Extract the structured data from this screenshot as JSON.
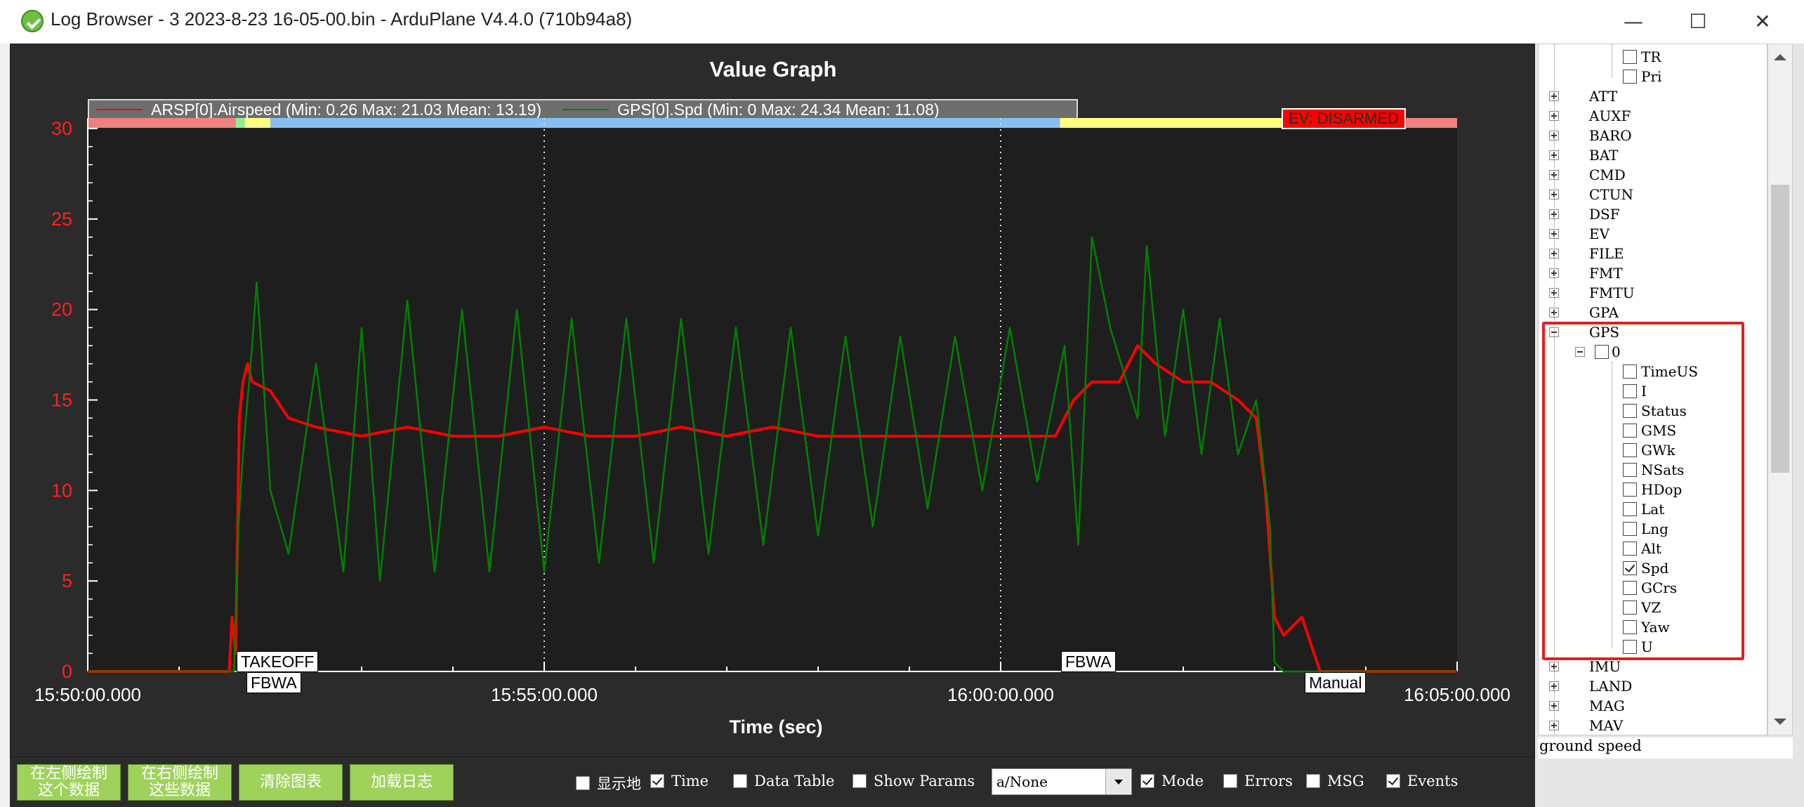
{
  "window": {
    "title": "Log Browser - 3 2023-8-23 16-05-00.bin - ArduPlane V4.4.0 (710b94a8)"
  },
  "graph": {
    "title": "Value Graph",
    "legend": [
      {
        "label": "ARSP[0].Airspeed  (Min: 0.26 Max: 21.03 Mean: 13.19)",
        "color": "#ff0000"
      },
      {
        "label": "GPS[0].Spd  (Min: 0 Max: 24.34 Mean: 11.08)",
        "color": "#008000"
      }
    ],
    "event_label": "EV: DISARMED",
    "modes": [
      "TAKEOFF",
      "FBWA",
      "FBWA",
      "Manual"
    ]
  },
  "chart_data": {
    "type": "line",
    "title": "Value Graph",
    "xlabel": "Time (sec)",
    "ylabel": "",
    "x_ticks": [
      "15:50:00.000",
      "15:55:00.000",
      "16:00:00.000",
      "16:05:00.000"
    ],
    "xlim_minutes": [
      0,
      15
    ],
    "ylim": [
      0,
      30
    ],
    "y_ticks": [
      0,
      5,
      10,
      15,
      20,
      25,
      30
    ],
    "grid": "vertical dotted at major x ticks",
    "series": [
      {
        "name": "ARSP[0].Airspeed",
        "color": "#ff0000",
        "x_minutes": [
          0,
          1.55,
          1.58,
          1.62,
          1.66,
          1.7,
          1.75,
          1.8,
          2.0,
          2.2,
          2.5,
          3.0,
          3.5,
          4.0,
          4.5,
          5.0,
          5.5,
          6.0,
          6.5,
          7.0,
          7.5,
          8.0,
          8.5,
          9.0,
          9.5,
          10.0,
          10.6,
          10.8,
          11.0,
          11.3,
          11.5,
          11.7,
          12.0,
          12.3,
          12.6,
          12.8,
          12.9,
          13.0,
          13.1,
          13.3,
          13.5,
          15
        ],
        "values": [
          0,
          0,
          3,
          1,
          14,
          16,
          17,
          16,
          15.5,
          14,
          13.5,
          13,
          13.5,
          13,
          13,
          13.5,
          13,
          13,
          13.5,
          13,
          13.5,
          13,
          13,
          13,
          13,
          13,
          13,
          15,
          16,
          16,
          18,
          17,
          16,
          16,
          15,
          14,
          10,
          3,
          2,
          3,
          0,
          0
        ]
      },
      {
        "name": "GPS[0].Spd",
        "color": "#008000",
        "x_minutes": [
          0,
          1.6,
          1.65,
          1.7,
          1.8,
          1.85,
          1.9,
          2.0,
          2.2,
          2.5,
          2.8,
          3.0,
          3.2,
          3.5,
          3.8,
          4.1,
          4.4,
          4.7,
          5.0,
          5.3,
          5.6,
          5.9,
          6.2,
          6.5,
          6.8,
          7.1,
          7.4,
          7.7,
          8.0,
          8.3,
          8.6,
          8.9,
          9.2,
          9.5,
          9.8,
          10.1,
          10.4,
          10.7,
          10.85,
          11.0,
          11.2,
          11.5,
          11.6,
          11.8,
          12.0,
          12.2,
          12.4,
          12.6,
          12.8,
          12.95,
          13.0,
          13.1,
          13.3,
          13.5,
          15
        ],
        "values": [
          0,
          0,
          8,
          12,
          18,
          21.5,
          18,
          10,
          6.5,
          17,
          5.5,
          19,
          5,
          20.5,
          5.5,
          20,
          5.5,
          20,
          5.5,
          19.5,
          6,
          19.5,
          6,
          19.5,
          6.5,
          19,
          7,
          19,
          7.5,
          18.5,
          8,
          18.5,
          9,
          18.5,
          10,
          19,
          10.5,
          18,
          7,
          24,
          19,
          14,
          23.5,
          13,
          20,
          12,
          19.5,
          12,
          15,
          8,
          0.5,
          0,
          0,
          0,
          0
        ]
      }
    ],
    "mode_bar": [
      {
        "from_minutes": 0,
        "to_minutes": 1.62,
        "color": "#f08080"
      },
      {
        "from_minutes": 1.62,
        "to_minutes": 1.72,
        "color": "#90ee90"
      },
      {
        "from_minutes": 1.72,
        "to_minutes": 2.0,
        "color": "#ffff80"
      },
      {
        "from_minutes": 2.0,
        "to_minutes": 10.65,
        "color": "#87bff0"
      },
      {
        "from_minutes": 10.65,
        "to_minutes": 13.35,
        "color": "#ffff80"
      },
      {
        "from_minutes": 13.35,
        "to_minutes": 15,
        "color": "#f08080"
      }
    ]
  },
  "controls": {
    "buttons": [
      "在左侧绘制\n这个数据",
      "在右侧绘制\n这些数据",
      "清除图表",
      "加载日志"
    ],
    "show_map_label": "显示地",
    "time_label": "Time",
    "data_table_label": "Data Table",
    "show_params_label": "Show Params",
    "combo_value": "a/None",
    "mode_label": "Mode",
    "errors_label": "Errors",
    "msg_label": "MSG",
    "events_label": "Events"
  },
  "tree": {
    "top_children": [
      "TR",
      "Pri"
    ],
    "items_before": [
      "ATT",
      "AUXF",
      "BARO",
      "BAT",
      "CMD",
      "CTUN",
      "DSF",
      "EV",
      "FILE",
      "FMT",
      "FMTU",
      "GPA"
    ],
    "gps": "GPS",
    "gps_instance": "0",
    "gps_fields": [
      "TimeUS",
      "I",
      "Status",
      "GMS",
      "GWk",
      "NSats",
      "HDop",
      "Lat",
      "Lng",
      "Alt",
      "Spd",
      "GCrs",
      "VZ",
      "Yaw",
      "U"
    ],
    "gps_checked": "Spd",
    "items_after": [
      "IMU",
      "LAND",
      "MAG",
      "MAV"
    ]
  },
  "status": {
    "description": "ground speed"
  }
}
